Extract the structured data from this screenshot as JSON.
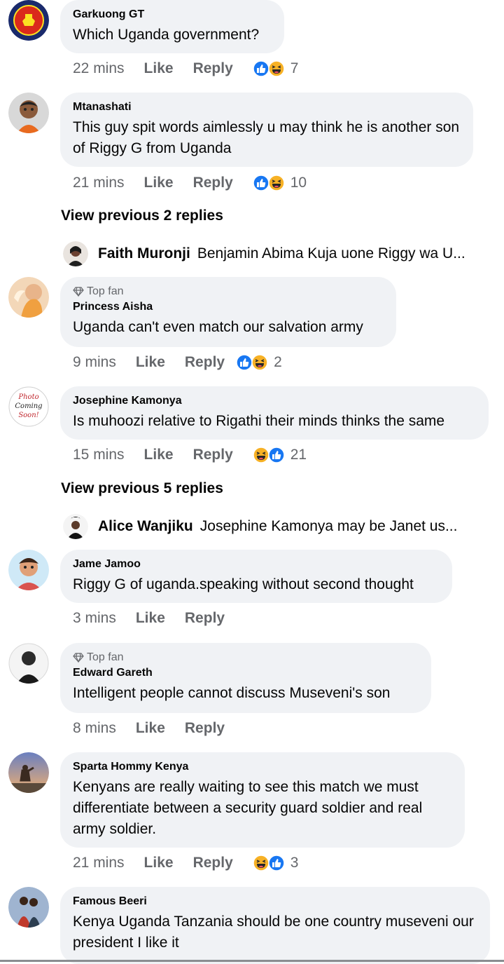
{
  "comments": [
    {
      "name": "Garkuong GT",
      "top_fan": "",
      "text": "Which Uganda government?",
      "time": "22 mins",
      "like": "Like",
      "reply": "Reply",
      "reactions": [
        "like",
        "haha"
      ],
      "count": "7",
      "avatar_icon": "manchester-united-crest-icon"
    },
    {
      "name": "Mtanashati",
      "top_fan": "",
      "text": "This guy spit words aimlessly u may think he is another son of Riggy G from Uganda",
      "time": "21 mins",
      "like": "Like",
      "reply": "Reply",
      "reactions": [
        "like",
        "haha"
      ],
      "count": "10",
      "avatar_icon": "cartoon-person-icon"
    },
    {
      "name": "Princess Aisha",
      "top_fan": "Top fan",
      "text": "Uganda can't even match our salvation army",
      "time": "9 mins",
      "like": "Like",
      "reply": "Reply",
      "reactions": [
        "like",
        "haha"
      ],
      "count": "2",
      "avatar_icon": "woman-photo-icon"
    },
    {
      "name": "Josephine Kamonya",
      "top_fan": "",
      "text": "Is muhoozi relative to Rigathi their minds thinks the same",
      "time": "15 mins",
      "like": "Like",
      "reply": "Reply",
      "reactions": [
        "haha",
        "like"
      ],
      "count": "21",
      "avatar_icon": "photo-coming-soon-icon",
      "avatar_text": [
        "Photo",
        "Coming",
        "Soon!"
      ]
    },
    {
      "name": "Jame Jamoo",
      "top_fan": "",
      "text": "Riggy G of uganda.speaking without second thought",
      "time": "3 mins",
      "like": "Like",
      "reply": "Reply",
      "reactions": [],
      "count": "",
      "avatar_icon": "3d-avatar-icon"
    },
    {
      "name": "Edward Gareth",
      "top_fan": "Top fan",
      "text": "Intelligent people cannot discuss Museveni's son",
      "time": "8 mins",
      "like": "Like",
      "reply": "Reply",
      "reactions": [],
      "count": "",
      "avatar_icon": "man-photo-icon"
    },
    {
      "name": "Sparta Hommy Kenya",
      "top_fan": "",
      "text": "Kenyans are really waiting to see this match we must differentiate between a security guard soldier and real army soldier.",
      "time": "21 mins",
      "like": "Like",
      "reply": "Reply",
      "reactions": [
        "haha",
        "like"
      ],
      "count": "3",
      "avatar_icon": "sunset-photo-icon"
    },
    {
      "name": "Famous Beeri",
      "top_fan": "",
      "text": "Kenya  Uganda Tanzania should be one country museveni our president I like it",
      "time": "",
      "like": "",
      "reply": "",
      "reactions": [],
      "count": "",
      "avatar_icon": "couple-photo-icon"
    }
  ],
  "view_previous": [
    {
      "label": "View previous 2 replies",
      "reply_name": "Faith Muronji",
      "reply_text": "Benjamin Abima Kuja uone Riggy wa U..."
    },
    {
      "label": "View previous 5 replies",
      "reply_name": "Alice Wanjiku",
      "reply_text": "Josephine Kamonya may be Janet us..."
    }
  ],
  "colors": {
    "like_blue": "#1877f2",
    "haha_yellow": "#f7b125",
    "bubble": "#f0f2f5",
    "meta": "#65676b"
  }
}
